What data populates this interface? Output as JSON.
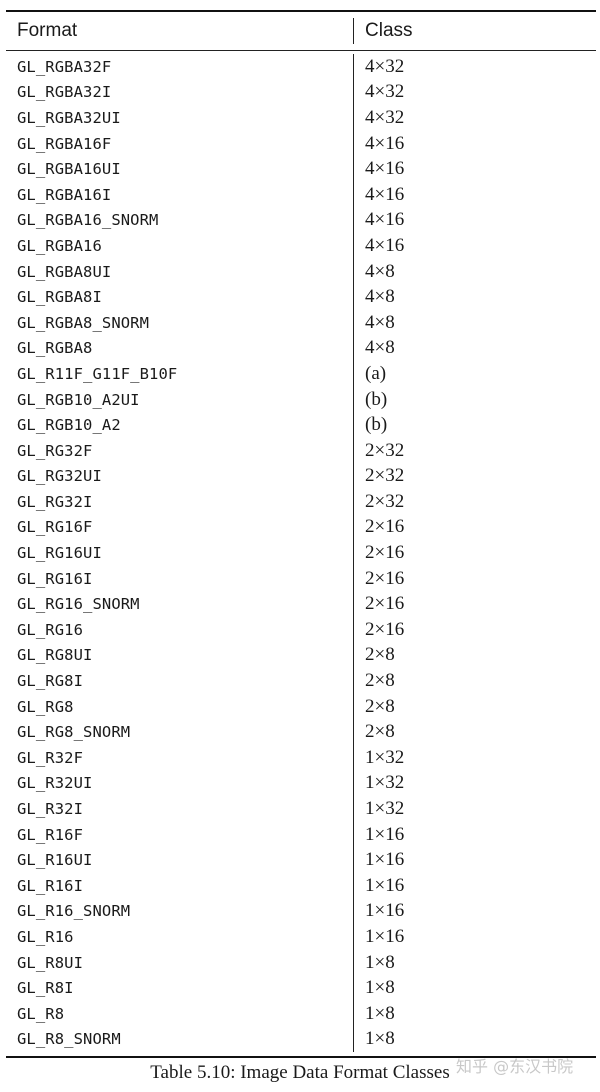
{
  "table": {
    "headers": {
      "format": "Format",
      "class": "Class"
    },
    "rows": [
      {
        "format": "GL_RGBA32F",
        "class": "4×32"
      },
      {
        "format": "GL_RGBA32I",
        "class": "4×32"
      },
      {
        "format": "GL_RGBA32UI",
        "class": "4×32"
      },
      {
        "format": "GL_RGBA16F",
        "class": "4×16"
      },
      {
        "format": "GL_RGBA16UI",
        "class": "4×16"
      },
      {
        "format": "GL_RGBA16I",
        "class": "4×16"
      },
      {
        "format": "GL_RGBA16_SNORM",
        "class": "4×16"
      },
      {
        "format": "GL_RGBA16",
        "class": "4×16"
      },
      {
        "format": "GL_RGBA8UI",
        "class": "4×8"
      },
      {
        "format": "GL_RGBA8I",
        "class": "4×8"
      },
      {
        "format": "GL_RGBA8_SNORM",
        "class": "4×8"
      },
      {
        "format": "GL_RGBA8",
        "class": "4×8"
      },
      {
        "format": "GL_R11F_G11F_B10F",
        "class": "(a)"
      },
      {
        "format": "GL_RGB10_A2UI",
        "class": "(b)"
      },
      {
        "format": "GL_RGB10_A2",
        "class": "(b)"
      },
      {
        "format": "GL_RG32F",
        "class": "2×32"
      },
      {
        "format": "GL_RG32UI",
        "class": "2×32"
      },
      {
        "format": "GL_RG32I",
        "class": "2×32"
      },
      {
        "format": "GL_RG16F",
        "class": "2×16"
      },
      {
        "format": "GL_RG16UI",
        "class": "2×16"
      },
      {
        "format": "GL_RG16I",
        "class": "2×16"
      },
      {
        "format": "GL_RG16_SNORM",
        "class": "2×16"
      },
      {
        "format": "GL_RG16",
        "class": "2×16"
      },
      {
        "format": "GL_RG8UI",
        "class": "2×8"
      },
      {
        "format": "GL_RG8I",
        "class": "2×8"
      },
      {
        "format": "GL_RG8",
        "class": "2×8"
      },
      {
        "format": "GL_RG8_SNORM",
        "class": "2×8"
      },
      {
        "format": "GL_R32F",
        "class": "1×32"
      },
      {
        "format": "GL_R32UI",
        "class": "1×32"
      },
      {
        "format": "GL_R32I",
        "class": "1×32"
      },
      {
        "format": "GL_R16F",
        "class": "1×16"
      },
      {
        "format": "GL_R16UI",
        "class": "1×16"
      },
      {
        "format": "GL_R16I",
        "class": "1×16"
      },
      {
        "format": "GL_R16_SNORM",
        "class": "1×16"
      },
      {
        "format": "GL_R16",
        "class": "1×16"
      },
      {
        "format": "GL_R8UI",
        "class": "1×8"
      },
      {
        "format": "GL_R8I",
        "class": "1×8"
      },
      {
        "format": "GL_R8",
        "class": "1×8"
      },
      {
        "format": "GL_R8_SNORM",
        "class": "1×8"
      }
    ]
  },
  "caption": "Table 5.10: Image Data Format Classes",
  "watermark": "知乎 @东汉书院"
}
